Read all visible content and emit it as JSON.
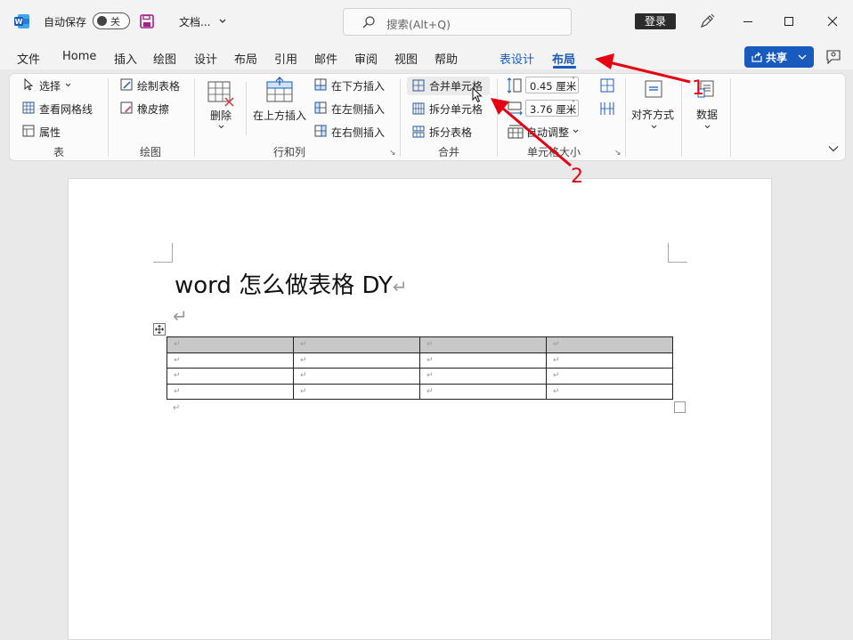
{
  "titlebar": {
    "autosave_label": "自动保存",
    "autosave_state": "关",
    "doc_name": "文档...",
    "search_placeholder": "搜索(Alt+Q)",
    "login_label": "登录"
  },
  "tabs": [
    {
      "label": "文件"
    },
    {
      "label": "Home"
    },
    {
      "label": "插入"
    },
    {
      "label": "绘图"
    },
    {
      "label": "设计"
    },
    {
      "label": "布局"
    },
    {
      "label": "引用"
    },
    {
      "label": "邮件"
    },
    {
      "label": "审阅"
    },
    {
      "label": "视图"
    },
    {
      "label": "帮助"
    },
    {
      "label": "表设计"
    },
    {
      "label": "布局"
    }
  ],
  "share_label": "共享",
  "ribbon": {
    "table": {
      "select": "选择",
      "gridlines": "查看网格线",
      "properties": "属性",
      "group": "表"
    },
    "draw": {
      "draw_table": "绘制表格",
      "eraser": "橡皮擦",
      "group": "绘图"
    },
    "rows_cols": {
      "delete": "删除",
      "insert_above": "在上方插入",
      "insert_below": "在下方插入",
      "insert_left": "在左侧插入",
      "insert_right": "在右侧插入",
      "group": "行和列"
    },
    "merge": {
      "merge_cells": "合并单元格",
      "split_cells": "拆分单元格",
      "split_table": "拆分表格",
      "group": "合并"
    },
    "cell_size": {
      "height_value": "0.45 厘米",
      "width_value": "3.76 厘米",
      "autofit": "自动调整",
      "group": "单元格大小"
    },
    "alignment": {
      "label": "对齐方式"
    },
    "data": {
      "label": "数据"
    }
  },
  "document": {
    "title": "word 怎么做表格 DY",
    "para_mark": "↵",
    "table": {
      "rows": [
        [
          "↵",
          "↵",
          "↵",
          "↵"
        ],
        [
          "↵",
          "↵",
          "↵",
          "↵"
        ],
        [
          "↵",
          "↵",
          "↵",
          "↵"
        ],
        [
          "↵",
          "↵",
          "↵",
          "↵"
        ]
      ]
    }
  },
  "annotations": {
    "num1": "1",
    "num2": "2",
    "color": "#e60012"
  }
}
